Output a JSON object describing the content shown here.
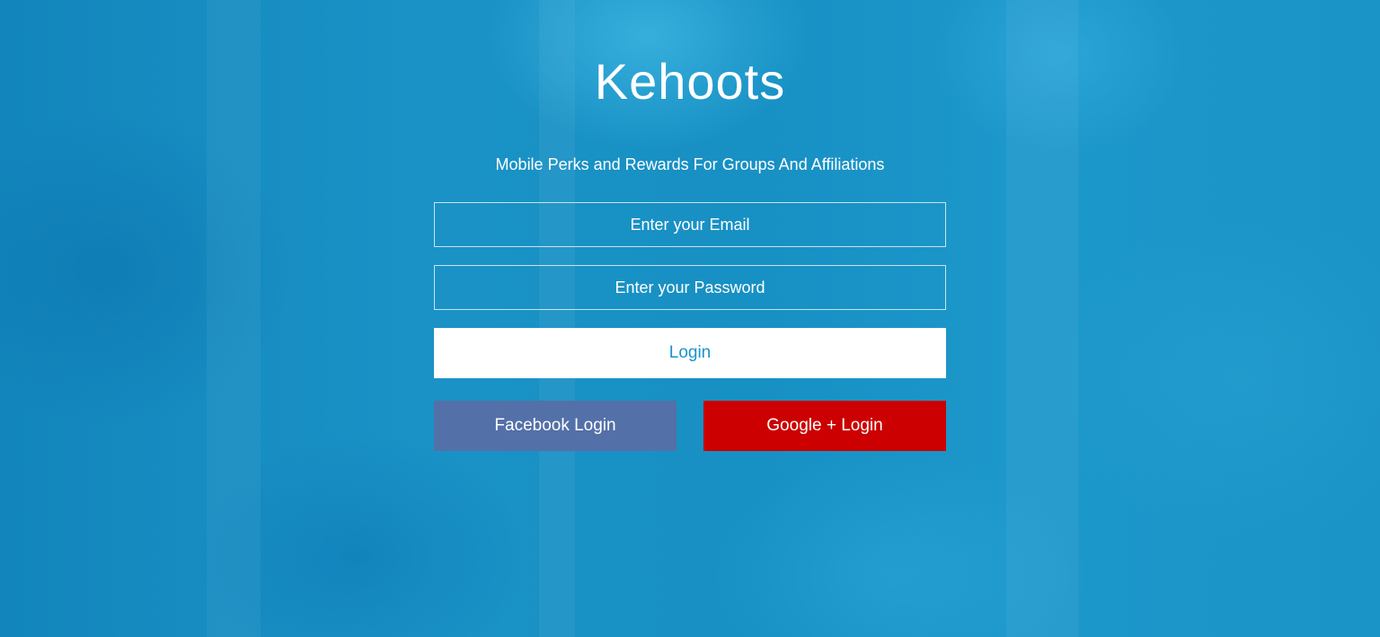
{
  "brand": {
    "title": "Kehoots",
    "tagline": "Mobile Perks and Rewards For Groups And Affiliations"
  },
  "form": {
    "email_placeholder": "Enter your Email",
    "email_value": "",
    "password_placeholder": "Enter your Password",
    "password_value": "",
    "login_label": "Login"
  },
  "social": {
    "facebook_label": "Facebook Login",
    "google_label": "Google + Login"
  },
  "colors": {
    "background": "#1488bf",
    "login_text": "#1a93c9",
    "facebook": "#5370a8",
    "google": "#cc0000"
  }
}
